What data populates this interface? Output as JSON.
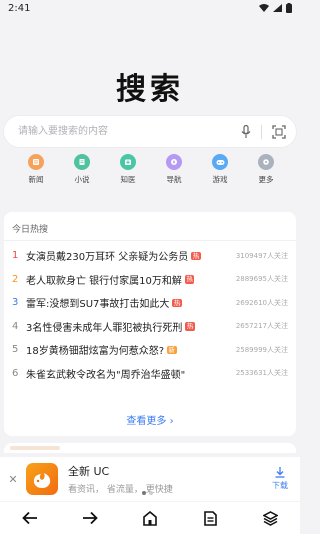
{
  "status": {
    "time": "2:41"
  },
  "logo": {
    "text": "搜索"
  },
  "search": {
    "placeholder": "请输入要搜索的内容"
  },
  "shortcuts": [
    {
      "label": "新闻",
      "icon": "news-icon",
      "color": "#f5a35b"
    },
    {
      "label": "小说",
      "icon": "novel-icon",
      "color": "#4fc3a0"
    },
    {
      "label": "知医",
      "icon": "medical-icon",
      "color": "#49c6a6"
    },
    {
      "label": "导航",
      "icon": "navigation-icon",
      "color": "#b49af0"
    },
    {
      "label": "游戏",
      "icon": "game-icon",
      "color": "#5aa9f4"
    },
    {
      "label": "更多",
      "icon": "more-icon",
      "color": "#a9b2bd"
    }
  ],
  "hot": {
    "title": "今日热搜",
    "items": [
      {
        "rank": "1",
        "title": "女演员戴230万耳环 父亲疑为公务员",
        "tag": "热",
        "tag_color": "#f25a4b",
        "count": "3109497人关注",
        "rank_color": "#f04a3d"
      },
      {
        "rank": "2",
        "title": "老人取款身亡 银行付家属10万和解",
        "tag": "热",
        "tag_color": "#f25a4b",
        "count": "2889695人关注",
        "rank_color": "#f7931e"
      },
      {
        "rank": "3",
        "title": "雷军:没想到SU7事故打击如此大",
        "tag": "热",
        "tag_color": "#f25a4b",
        "count": "2692610人关注",
        "rank_color": "#3b7cf3"
      },
      {
        "rank": "4",
        "title": "3名性侵害未成年人罪犯被执行死刑",
        "tag": "热",
        "tag_color": "#f25a4b",
        "count": "2657217人关注",
        "rank_color": "#888888"
      },
      {
        "rank": "5",
        "title": "18岁黄杨钿甜炫富为何惹众怒?",
        "tag": "新",
        "tag_color": "#f7a13a",
        "count": "2589999人关注",
        "rank_color": "#888888"
      },
      {
        "rank": "6",
        "title": "朱雀玄武敕令改名为\"周乔治华盛顿\"",
        "tag": "",
        "tag_color": "",
        "count": "2533631人关注",
        "rank_color": "#888888"
      }
    ],
    "more": "查看更多"
  },
  "banner": {
    "close": "✕",
    "title": "全新 UC",
    "subtitle": "看资讯， 省流量， 更快捷",
    "download": "下载"
  },
  "nav": [
    "back-icon",
    "forward-icon",
    "home-icon",
    "page-icon",
    "layers-icon"
  ]
}
